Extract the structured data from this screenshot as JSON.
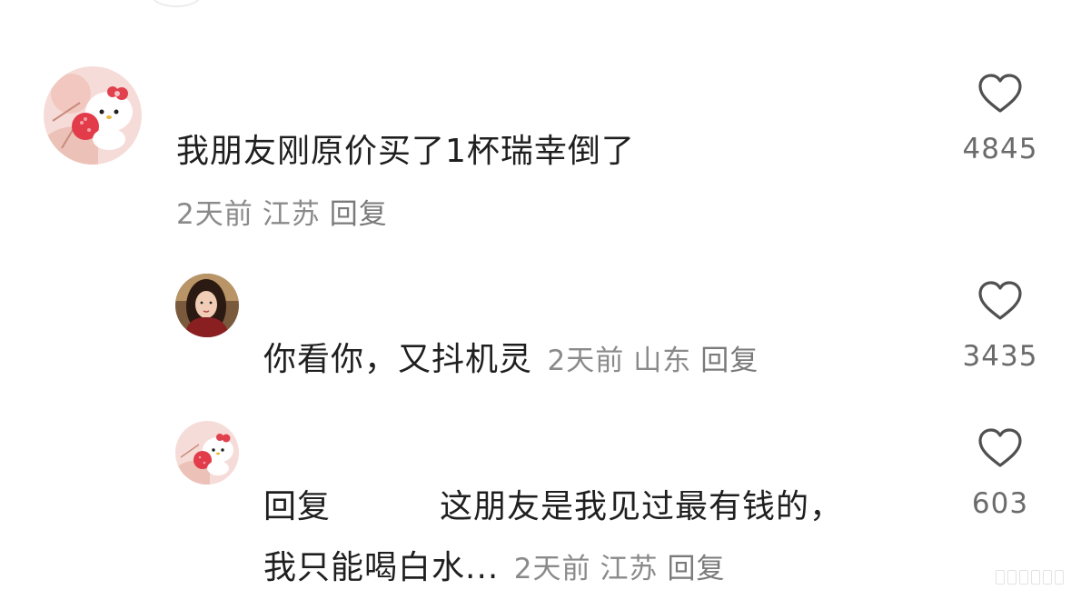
{
  "comments": [
    {
      "text": "我朋友刚原价买了1杯瑞幸倒了",
      "time": "2天前",
      "location": "江苏",
      "reply_label": "回复",
      "likes": "4845",
      "replies": [
        {
          "text": "你看你，又抖机灵",
          "time": "2天前",
          "location": "山东",
          "reply_label": "回复",
          "likes": "3435"
        },
        {
          "prefix": "回复",
          "text_line1": "这朋友是我见过最有钱的，",
          "text_line2": "我只能喝白水...",
          "time": "2天前",
          "location": "江苏",
          "reply_label": "回复",
          "likes": "603"
        }
      ]
    }
  ],
  "icons": {
    "like": "heart-outline-icon",
    "avatar_1": "hello-kitty-avatar",
    "avatar_2": "portrait-avatar",
    "avatar_3": "hello-kitty-avatar"
  },
  "colors": {
    "text": "#1f1f1f",
    "meta": "#8a8a8a",
    "count": "#6b6b6b",
    "background": "#ffffff"
  }
}
